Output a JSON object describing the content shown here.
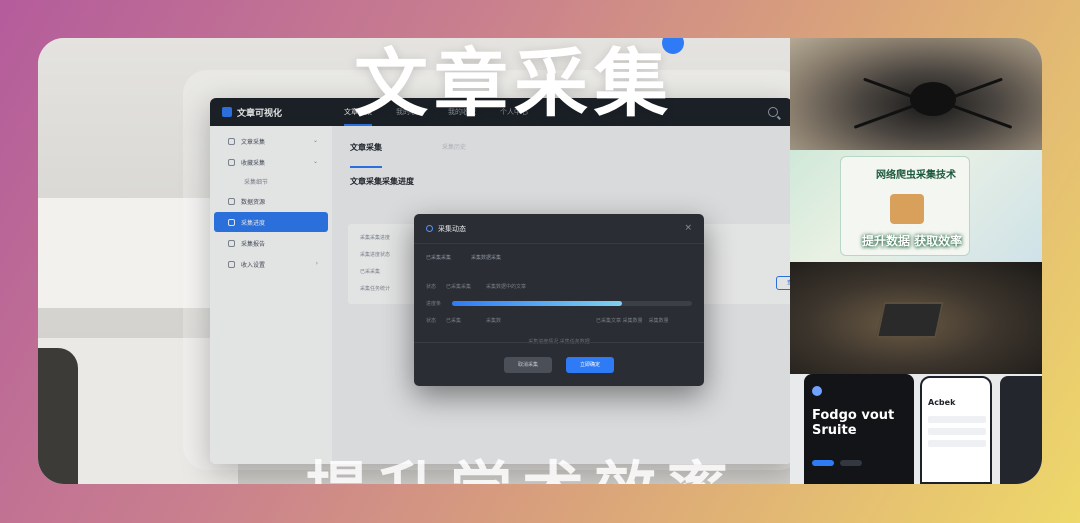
{
  "banner": {
    "top_title": "文章采集",
    "bottom_title": "提升学术效率"
  },
  "app": {
    "logo_text": "文章可视化",
    "nav": [
      {
        "label": "文章采集",
        "active": true
      },
      {
        "label": "我的收藏",
        "active": false
      },
      {
        "label": "我的收藏",
        "active": false
      },
      {
        "label": "个人中心",
        "active": false
      }
    ],
    "sidebar": [
      {
        "label": "文章采集",
        "chevron": "⌄"
      },
      {
        "label": "收藏采集",
        "chevron": "⌄"
      },
      {
        "label": "采集细节",
        "sub": true
      },
      {
        "label": "数据资源"
      },
      {
        "label": "采集进度",
        "active": true
      },
      {
        "label": "采集报告"
      },
      {
        "label": "收入设置",
        "chevron": "›"
      }
    ],
    "main": {
      "tabs": [
        "文章采集",
        "采集历史"
      ],
      "section_title": "文章采集采集进度",
      "panel_lines": [
        "采集采集进度",
        "采集进度状态",
        "已采采集",
        "采集任务统计"
      ],
      "panel2_button": "查看"
    }
  },
  "modal": {
    "title": "采集动态",
    "close": "×",
    "steps": [
      "已采集采集",
      "采集数据采集"
    ],
    "rows": [
      {
        "label": "状态",
        "value": "已采集采集",
        "extra": "采集数据中的文章"
      },
      {
        "label": "进度条",
        "progress": 0.71
      },
      {
        "label": "状态",
        "value": "已采集",
        "extra": "采集数",
        "right": "已采集文章 采集数量",
        "right2": "采集数量"
      }
    ],
    "mid_text": "采集进度情况   采集任务数据",
    "cancel_label": "取消采集",
    "confirm_label": "立即确定"
  },
  "gallery": {
    "img2_title": "网络爬虫采集技术",
    "img2_caption": "提升数据 获取效率",
    "phone1_title": "Fodgo vout Sruite",
    "phone2_title": "Acbek"
  }
}
